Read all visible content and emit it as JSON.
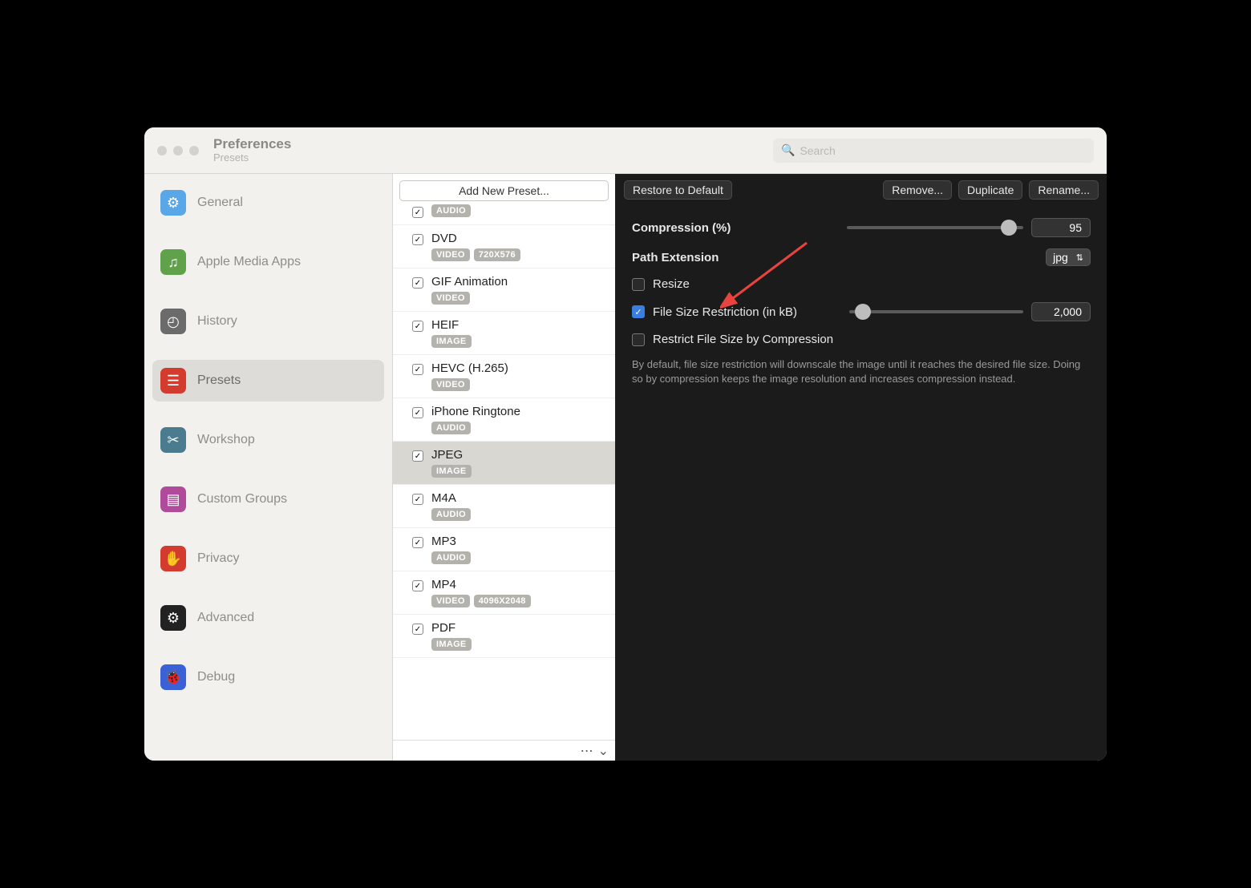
{
  "window": {
    "title": "Preferences",
    "subtitle": "Presets"
  },
  "search": {
    "placeholder": "Search"
  },
  "sidebar": {
    "items": [
      {
        "label": "General",
        "icon": "gear-icon",
        "bg": "#5aa7e8"
      },
      {
        "label": "Apple Media Apps",
        "icon": "media-icon",
        "bg": "#5fa24a"
      },
      {
        "label": "History",
        "icon": "clock-icon",
        "bg": "#6b6b6b"
      },
      {
        "label": "Presets",
        "icon": "presets-icon",
        "bg": "#d33b2f"
      },
      {
        "label": "Workshop",
        "icon": "tools-icon",
        "bg": "#4a7b8f"
      },
      {
        "label": "Custom Groups",
        "icon": "grid-icon",
        "bg": "#b04a9b"
      },
      {
        "label": "Privacy",
        "icon": "hand-icon",
        "bg": "#d33b2f"
      },
      {
        "label": "Advanced",
        "icon": "cog-icon",
        "bg": "#222222"
      },
      {
        "label": "Debug",
        "icon": "bug-icon",
        "bg": "#3a62d6"
      }
    ],
    "selected_index": 3
  },
  "middle": {
    "add_button": "Add New Preset..."
  },
  "presets": [
    {
      "name": "",
      "badges": [
        "AUDIO"
      ],
      "checked": true,
      "partial_top": true
    },
    {
      "name": "DVD",
      "badges": [
        "VIDEO",
        "720X576"
      ],
      "checked": true
    },
    {
      "name": "GIF Animation",
      "badges": [
        "VIDEO"
      ],
      "checked": true
    },
    {
      "name": "HEIF",
      "badges": [
        "IMAGE"
      ],
      "checked": true
    },
    {
      "name": "HEVC (H.265)",
      "badges": [
        "VIDEO"
      ],
      "checked": true
    },
    {
      "name": "iPhone Ringtone",
      "badges": [
        "AUDIO"
      ],
      "checked": true
    },
    {
      "name": "JPEG",
      "badges": [
        "IMAGE"
      ],
      "checked": true,
      "selected": true
    },
    {
      "name": "M4A",
      "badges": [
        "AUDIO"
      ],
      "checked": true
    },
    {
      "name": "MP3",
      "badges": [
        "AUDIO"
      ],
      "checked": true
    },
    {
      "name": "MP4",
      "badges": [
        "VIDEO",
        "4096X2048"
      ],
      "checked": true
    },
    {
      "name": "PDF",
      "badges": [
        "IMAGE"
      ],
      "checked": true
    }
  ],
  "detail": {
    "toolbar": {
      "restore": "Restore to Default",
      "remove": "Remove...",
      "duplicate": "Duplicate",
      "rename": "Rename..."
    },
    "compression": {
      "label": "Compression (%)",
      "value": "95",
      "percent": 92
    },
    "path_extension": {
      "label": "Path Extension",
      "value": "jpg"
    },
    "resize": {
      "label": "Resize",
      "checked": false
    },
    "file_size": {
      "label": "File Size Restriction (in kB)",
      "checked": true,
      "value": "2,000",
      "percent": 8
    },
    "restrict_compression": {
      "label": "Restrict File Size by Compression",
      "checked": false
    },
    "help": "By default, file size restriction will downscale the image until it reaches the desired file size. Doing so by compression keeps the image resolution and increases compression instead."
  },
  "icons": {
    "glyphs": {
      "gear-icon": "⚙",
      "media-icon": "♫",
      "clock-icon": "◴",
      "presets-icon": "☰",
      "tools-icon": "✂",
      "grid-icon": "▤",
      "hand-icon": "✋",
      "cog-icon": "⚙",
      "bug-icon": "🐞",
      "search-icon": "🔍",
      "chevron-updown-icon": "⇅",
      "chevron-down-icon": "⌄",
      "ellipsis-icon": "⋯",
      "check-icon": "✓"
    }
  }
}
